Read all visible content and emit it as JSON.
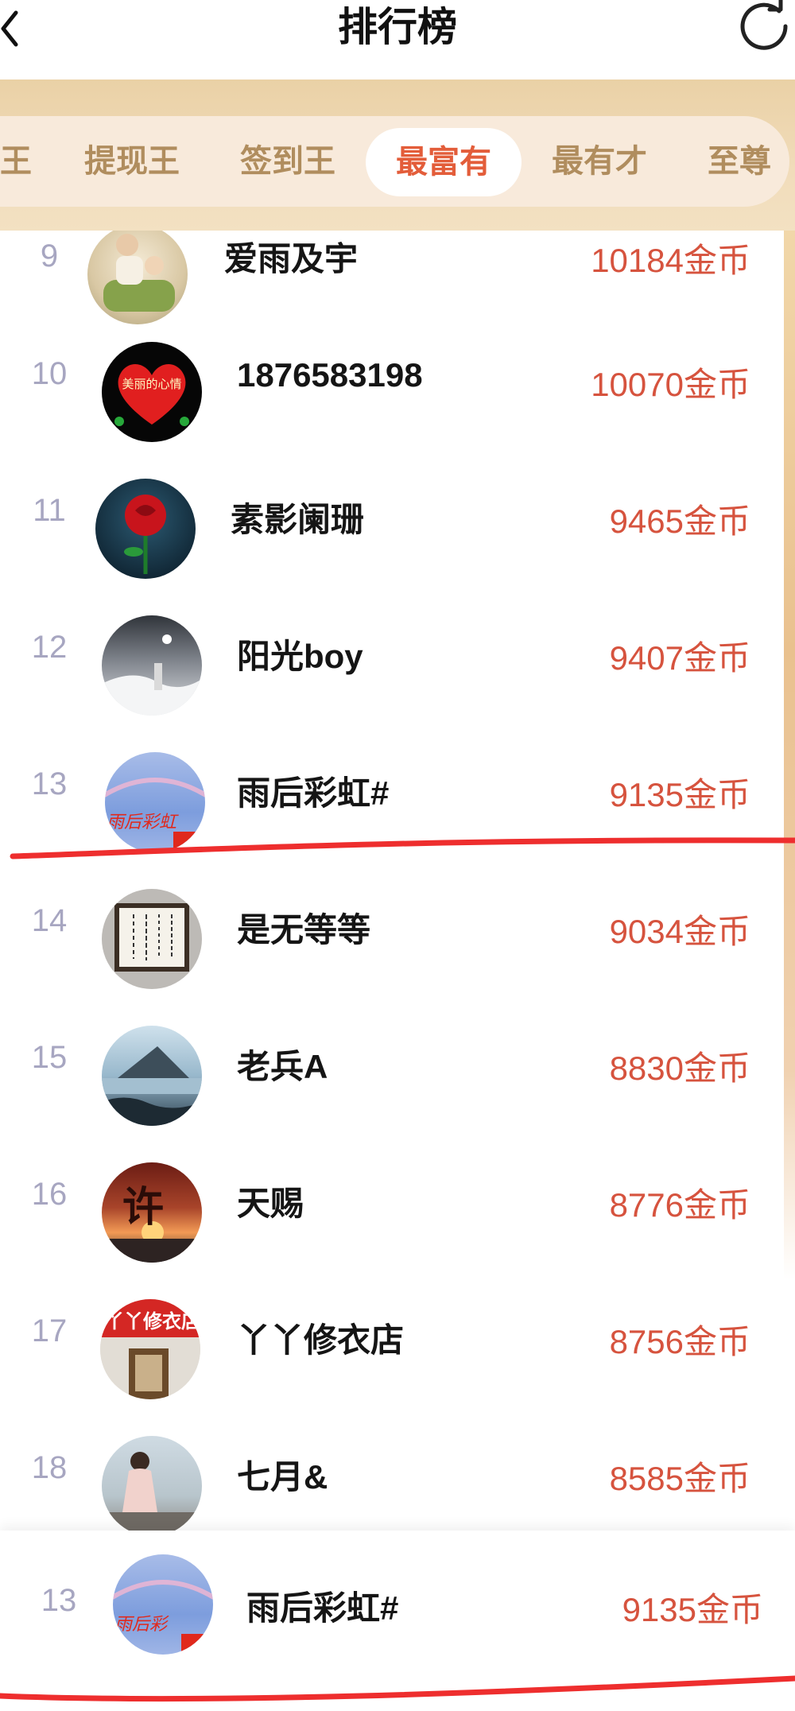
{
  "header": {
    "title": "排行榜",
    "back_icon": "chevron-left-icon",
    "refresh_icon": "refresh-icon"
  },
  "tabs": [
    {
      "label": "王",
      "active": false
    },
    {
      "label": "提现王",
      "active": false
    },
    {
      "label": "签到王",
      "active": false
    },
    {
      "label": "最富有",
      "active": true
    },
    {
      "label": "最有才",
      "active": false
    },
    {
      "label": "至尊",
      "active": false
    }
  ],
  "ranking": [
    {
      "rank": "9",
      "name": "爱雨及宇",
      "coins": "10184金币"
    },
    {
      "rank": "10",
      "name": "1876583198",
      "coins": "10070金币",
      "avatar_text": "美丽的心情"
    },
    {
      "rank": "11",
      "name": "素影阑珊",
      "coins": "9465金币"
    },
    {
      "rank": "12",
      "name": "阳光boy",
      "coins": "9407金币"
    },
    {
      "rank": "13",
      "name": "雨后彩虹#",
      "coins": "9135金币",
      "avatar_text": "雨后彩虹"
    },
    {
      "rank": "14",
      "name": "是无等等",
      "coins": "9034金币"
    },
    {
      "rank": "15",
      "name": "老兵A",
      "coins": "8830金币"
    },
    {
      "rank": "16",
      "name": "天赐",
      "coins": "8776金币",
      "avatar_text": "许"
    },
    {
      "rank": "17",
      "name": "丫丫修衣店",
      "coins": "8756金币",
      "avatar_text": "丫丫修衣店"
    },
    {
      "rank": "18",
      "name": "七月&",
      "coins": "8585金币"
    }
  ],
  "my_rank": {
    "rank": "13",
    "name": "雨后彩虹#",
    "coins": "9135金币",
    "avatar_text": "雨后彩"
  },
  "colors": {
    "accent": "#e35d3a",
    "coins": "#d6533e",
    "rank": "#a7a6c1",
    "tab_text": "#b08d5e",
    "annotation": "#ee2e2e"
  }
}
